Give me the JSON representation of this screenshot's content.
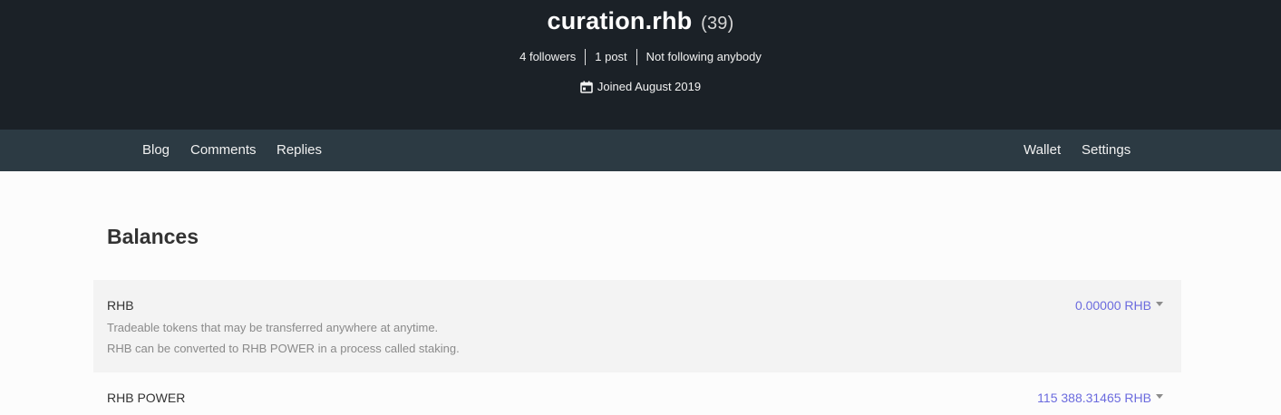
{
  "profile": {
    "name": "curation.rhb",
    "reputation": "(39)",
    "followers": "4 followers",
    "posts": "1 post",
    "following": "Not following anybody",
    "joined": "Joined August 2019"
  },
  "nav": {
    "left": [
      "Blog",
      "Comments",
      "Replies"
    ],
    "right": [
      "Wallet",
      "Settings"
    ]
  },
  "main": {
    "title": "Balances",
    "balances": [
      {
        "label": "RHB",
        "desc1": "Tradeable tokens that may be transferred anywhere at anytime.",
        "desc2": "RHB can be converted to RHB POWER in a process called staking.",
        "value": "0.00000 RHB"
      },
      {
        "label": "RHB POWER",
        "value": "115 388.31465 RHB"
      }
    ]
  },
  "icons": {
    "joined": "calendar-icon",
    "dropdown": "caret-down-icon"
  },
  "colors": {
    "header_bg": "#1b2127",
    "nav_bg": "#2c3a43",
    "accent": "#6b6bde",
    "row_shade": "#f3f3f3"
  }
}
